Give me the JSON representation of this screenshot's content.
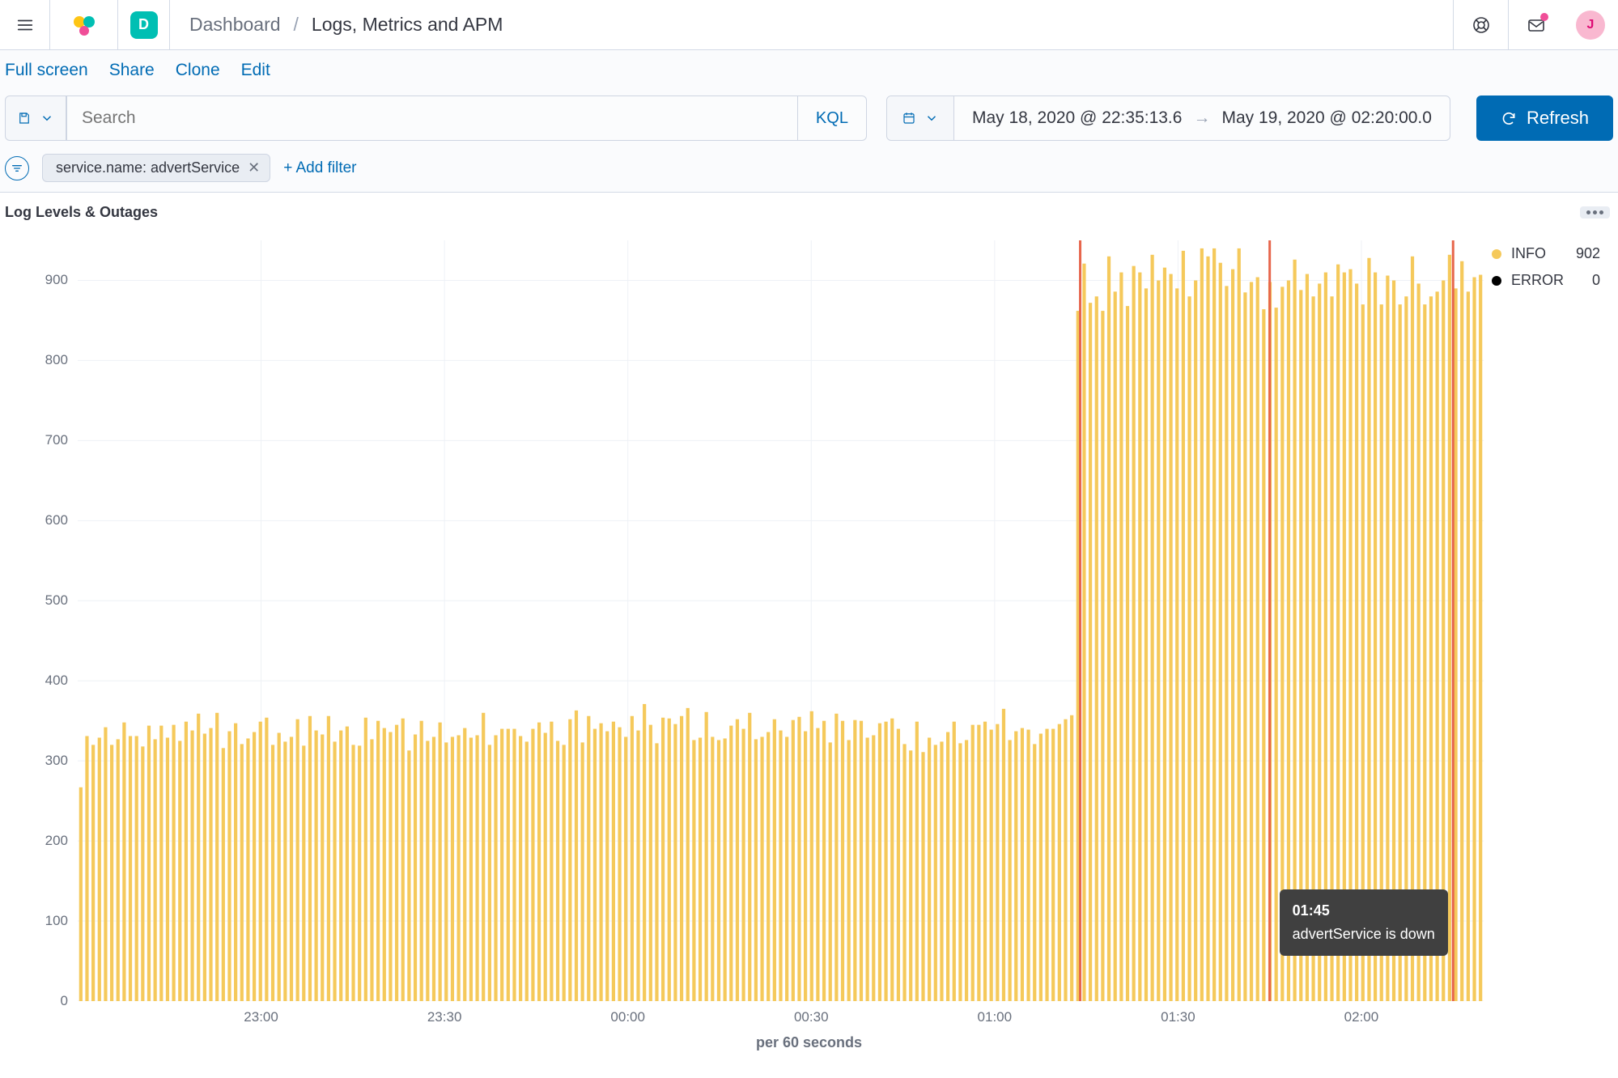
{
  "header": {
    "space_letter": "D",
    "breadcrumb_root": "Dashboard",
    "breadcrumb_current": "Logs, Metrics and APM",
    "avatar_letter": "J"
  },
  "subbar": {
    "full_screen": "Full screen",
    "share": "Share",
    "clone": "Clone",
    "edit": "Edit"
  },
  "query": {
    "search_placeholder": "Search",
    "kql_label": "KQL",
    "date_from": "May 18, 2020 @ 22:35:13.6",
    "date_to": "May 19, 2020 @ 02:20:00.0",
    "refresh_label": "Refresh"
  },
  "filters": {
    "pill_label": "service.name: advertService",
    "add_filter_label": "+ Add filter"
  },
  "panel": {
    "title": "Log Levels & Outages",
    "xaxis_title": "per 60 seconds"
  },
  "tooltip": {
    "time": "01:45",
    "message": "advertService is down"
  },
  "legend": {
    "info_label": "INFO",
    "info_value": "902",
    "error_label": "ERROR",
    "error_value": "0",
    "info_color": "#f5c95b",
    "error_color": "#000000"
  },
  "chart_data": {
    "type": "bar",
    "title": "Log Levels & Outages",
    "xlabel": "per 60 seconds",
    "ylabel": "",
    "ylim": [
      0,
      950
    ],
    "y_ticks": [
      0,
      100,
      200,
      300,
      400,
      500,
      600,
      700,
      800,
      900
    ],
    "x_range_minutes": [
      -5,
      225
    ],
    "x_ticks": [
      {
        "minute": 25,
        "label": "23:00"
      },
      {
        "minute": 55,
        "label": "23:30"
      },
      {
        "minute": 85,
        "label": "00:00"
      },
      {
        "minute": 115,
        "label": "00:30"
      },
      {
        "minute": 145,
        "label": "01:00"
      },
      {
        "minute": 175,
        "label": "01:30"
      },
      {
        "minute": 205,
        "label": "02:00"
      }
    ],
    "outage_markers_minutes": [
      159,
      190,
      220
    ],
    "series": [
      {
        "name": "INFO",
        "color": "#f5c95b",
        "values": [
          267,
          331,
          320,
          329,
          342,
          320,
          327,
          348,
          331,
          331,
          318,
          344,
          327,
          344,
          329,
          345,
          325,
          349,
          338,
          359,
          334,
          341,
          360,
          316,
          337,
          347,
          321,
          328,
          336,
          349,
          354,
          320,
          335,
          324,
          330,
          352,
          319,
          356,
          338,
          333,
          356,
          324,
          338,
          343,
          320,
          319,
          354,
          327,
          350,
          341,
          336,
          345,
          353,
          313,
          333,
          350,
          325,
          330,
          348,
          323,
          330,
          332,
          341,
          329,
          332,
          360,
          320,
          332,
          340,
          340,
          340,
          331,
          324,
          340,
          348,
          335,
          349,
          325,
          320,
          352,
          363,
          323,
          356,
          340,
          347,
          337,
          349,
          342,
          330,
          356,
          338,
          371,
          345,
          322,
          354,
          353,
          346,
          356,
          366,
          326,
          329,
          361,
          330,
          326,
          328,
          344,
          352,
          340,
          360,
          327,
          330,
          336,
          352,
          338,
          330,
          351,
          355,
          337,
          362,
          341,
          350,
          323,
          359,
          350,
          326,
          351,
          350,
          329,
          332,
          347,
          349,
          353,
          340,
          321,
          313,
          349,
          311,
          329,
          320,
          324,
          336,
          349,
          322,
          326,
          345,
          345,
          349,
          339,
          346,
          365,
          326,
          337,
          341,
          339,
          321,
          334,
          340,
          340,
          346,
          352,
          357,
          862,
          921,
          872,
          880,
          862,
          930,
          886,
          910,
          868,
          918,
          910,
          890,
          932,
          900,
          916,
          908,
          890,
          937,
          880,
          900,
          940,
          930,
          940,
          922,
          893,
          914,
          940,
          885,
          898,
          904,
          864,
          898,
          866,
          892,
          900,
          926,
          888,
          908,
          880,
          896,
          910,
          880,
          920,
          910,
          914,
          896,
          870,
          928,
          910,
          870,
          906,
          900,
          870,
          880,
          930,
          896,
          870,
          880,
          886,
          900,
          932,
          890,
          924,
          886,
          904,
          907
        ]
      },
      {
        "name": "ERROR",
        "color": "#000000",
        "values": []
      }
    ]
  }
}
